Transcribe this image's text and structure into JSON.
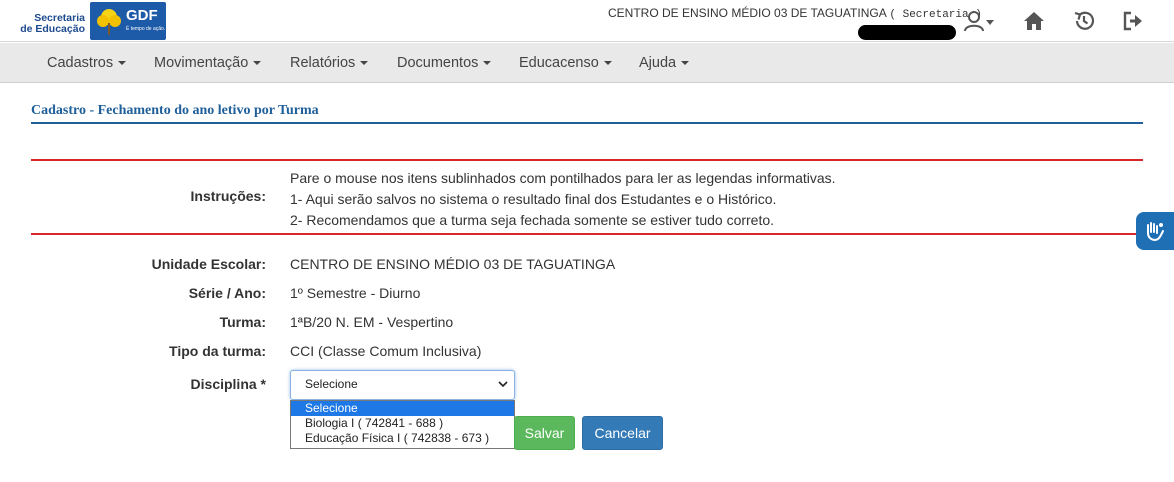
{
  "header": {
    "secretaria_line1": "Secretaria",
    "secretaria_line2": "de Educação",
    "gdf_logo_text": "GDF",
    "gdf_logo_sub": "É tempo de ação.",
    "school_name": "CENTRO DE ENSINO MÉDIO 03 DE TAGUATINGA",
    "role": "( Secretaria )",
    "icons": [
      "user-icon",
      "home-icon",
      "history-icon",
      "logout-icon"
    ]
  },
  "nav": {
    "items": [
      {
        "label": "Cadastros"
      },
      {
        "label": "Movimentação"
      },
      {
        "label": "Relatórios"
      },
      {
        "label": "Documentos"
      },
      {
        "label": "Educacenso"
      },
      {
        "label": "Ajuda"
      }
    ]
  },
  "page": {
    "title": "Cadastro - Fechamento do ano letivo por Turma"
  },
  "instructions": {
    "label": "Instruções:",
    "lines": [
      "Pare o mouse nos itens sublinhados com pontilhados para ler as legendas informativas.",
      "1- Aqui serão salvos no sistema o resultado final dos Estudantes e o Histórico.",
      "2- Recomendamos que a turma seja fechada somente se estiver tudo correto."
    ]
  },
  "form": {
    "unidade_label": "Unidade Escolar:",
    "unidade_value": "CENTRO DE ENSINO MÉDIO 03 DE TAGUATINGA",
    "serie_label": "Série / Ano:",
    "serie_value": "1º Semestre - Diurno",
    "turma_label": "Turma:",
    "turma_value": "1ªB/20 N. EM - Vespertino",
    "tipo_label": "Tipo da turma:",
    "tipo_value": "CCI (Classe Comum Inclusiva)",
    "disciplina_label": "Disciplina *",
    "disciplina_selected": "Selecione",
    "disciplina_options": [
      "Selecione",
      "Biologia I ( 742841 - 688 )",
      "Educação Física I ( 742838 - 673 )"
    ]
  },
  "buttons": {
    "save": "Salvar",
    "cancel": "Cancelar"
  },
  "colors": {
    "brand_blue": "#1f5f9a",
    "instruction_rule": "#d9262a",
    "save_green": "#5cb85c",
    "cancel_blue": "#337ab7",
    "dropdown_highlight": "#1e78e6"
  }
}
